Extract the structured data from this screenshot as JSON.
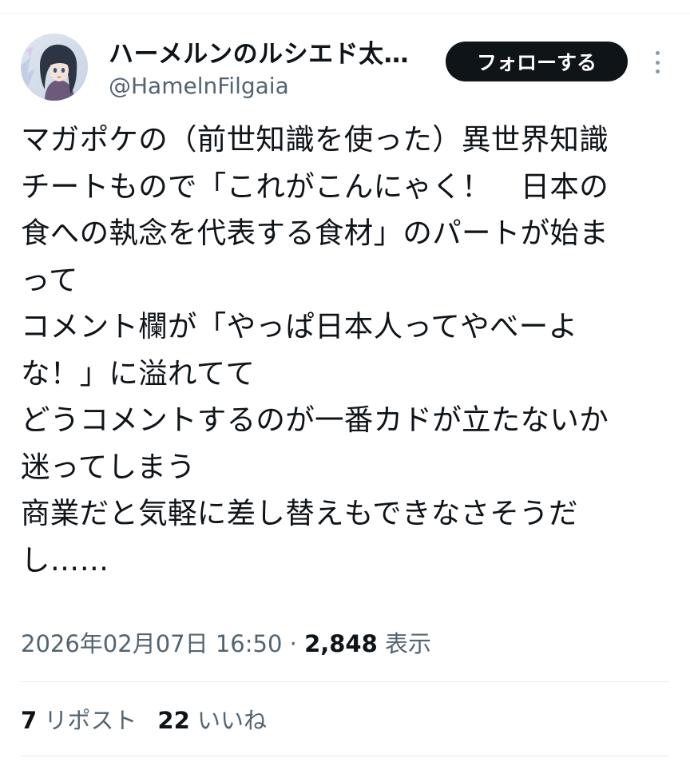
{
  "author": {
    "display_name": "ハーメルンのルシエド太…",
    "handle": "@HamelnFilgaia",
    "avatar_icon": "anime-girl-avatar-icon"
  },
  "actions": {
    "follow_label": "フォローする",
    "more_icon": "more-vertical-icon"
  },
  "tweet": {
    "lines": [
      "マガポケの（前世知識を使った）異世界知識",
      "チートもので「これがこんにゃく！　日本の",
      "食への執念を代表する食材」のパートが始ま",
      "って",
      "コメント欄が「やっぱ日本人ってやべーよ",
      "な！」に溢れてて",
      "どうコメントするのが一番カドが立たないか",
      "迷ってしまう",
      "商業だと気軽に差し替えもできなさそうだ",
      "し……"
    ]
  },
  "meta": {
    "timestamp": "2026年02月07日 16:50",
    "separator": " · ",
    "views_count": "2,848",
    "views_label": " 表示"
  },
  "stats": {
    "reposts_count": "7",
    "reposts_label": " リポスト",
    "likes_count": "22",
    "likes_label": " いいね"
  },
  "colors": {
    "text_primary": "#0f1419",
    "text_secondary": "#536471",
    "button_bg": "#0f1419",
    "divider": "#e6ecf0"
  }
}
